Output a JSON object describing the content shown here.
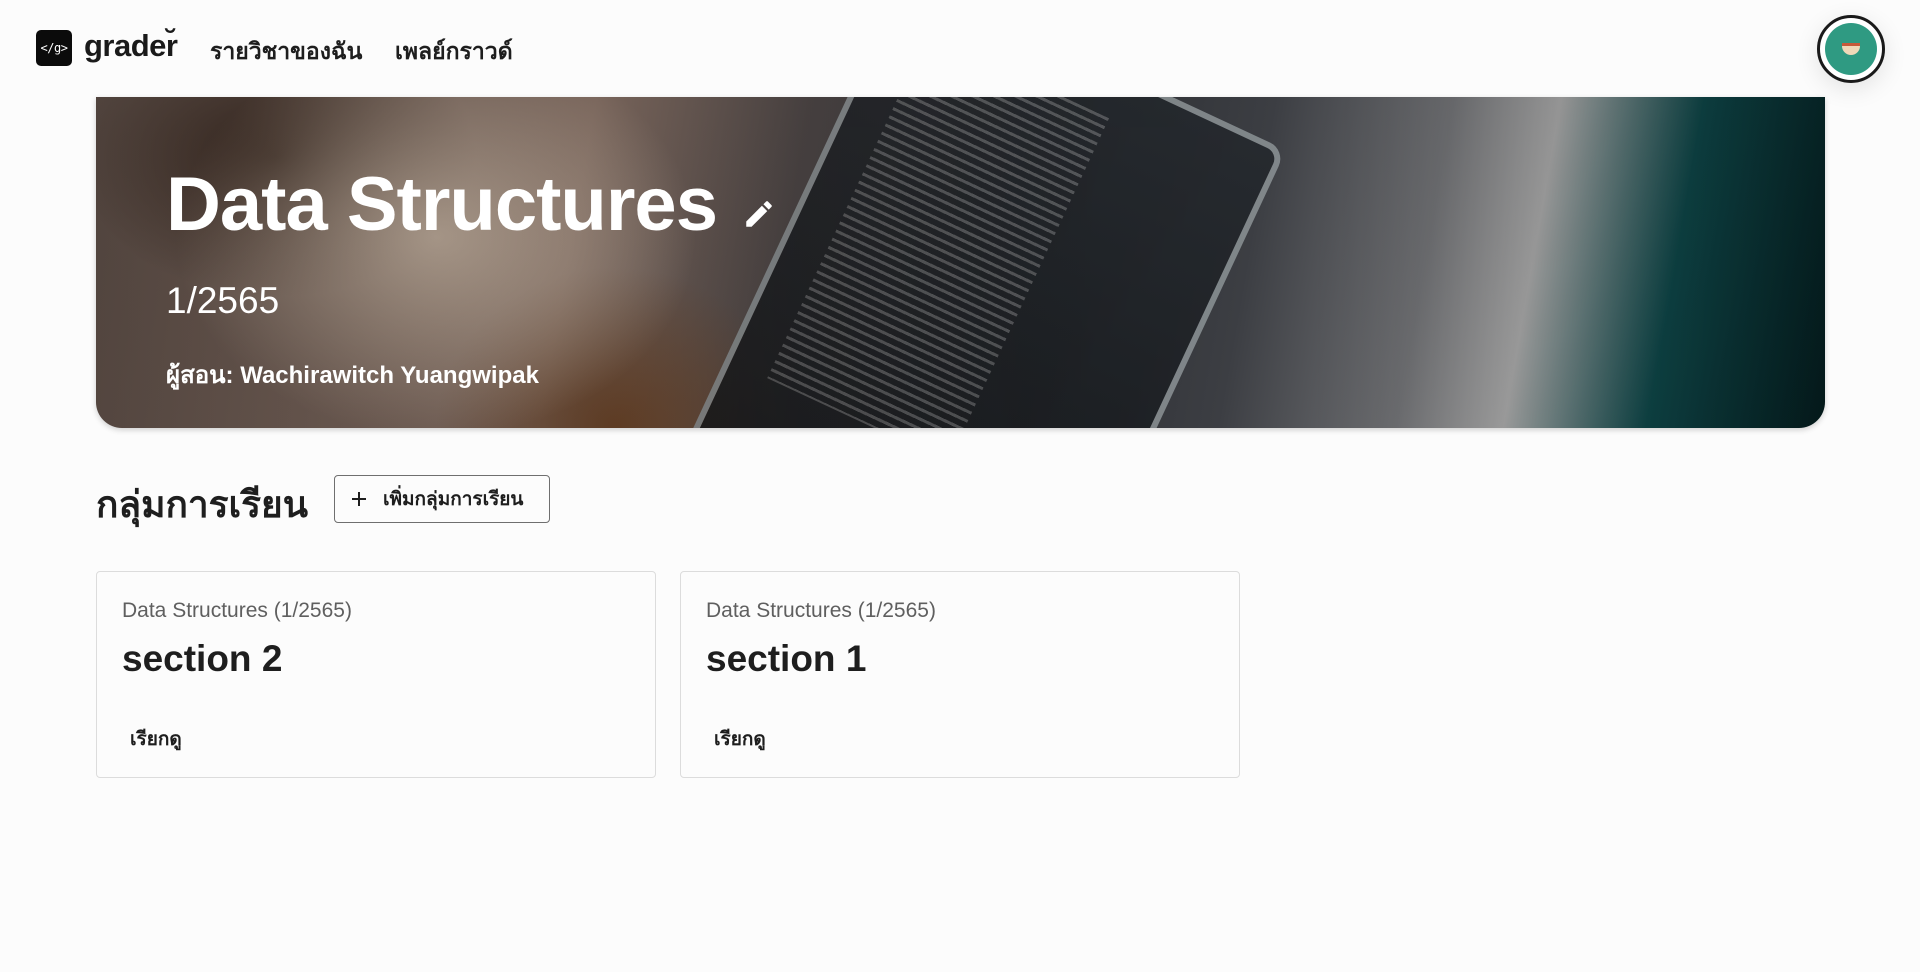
{
  "app": {
    "logo_text": "</g>",
    "brand": "grader̆"
  },
  "nav": {
    "courses": "รายวิชาของฉัน",
    "playground": "เพลย์กราวด์"
  },
  "user": {
    "avatar_icon": "user-avatar-icon"
  },
  "course": {
    "title": "Data Structures",
    "term": "1/2565",
    "instructor": "ผู้สอน: Wachirawitch Yuangwipak",
    "edit_icon": "pencil-icon"
  },
  "groups": {
    "heading": "กลุ่มการเรียน",
    "add_button": "เพิ่มกลุ่มการเรียน",
    "cards": [
      {
        "course_label": "Data Structures (1/2565)",
        "section": "section 2",
        "view": "เรียกดู"
      },
      {
        "course_label": "Data Structures (1/2565)",
        "section": "section 1",
        "view": "เรียกดู"
      }
    ]
  },
  "colors": {
    "background": "#fcfcfc",
    "text": "#1e1e1e",
    "muted": "#5f5f5f",
    "border": "#dcdcdc",
    "avatar": "#2f9a82"
  }
}
